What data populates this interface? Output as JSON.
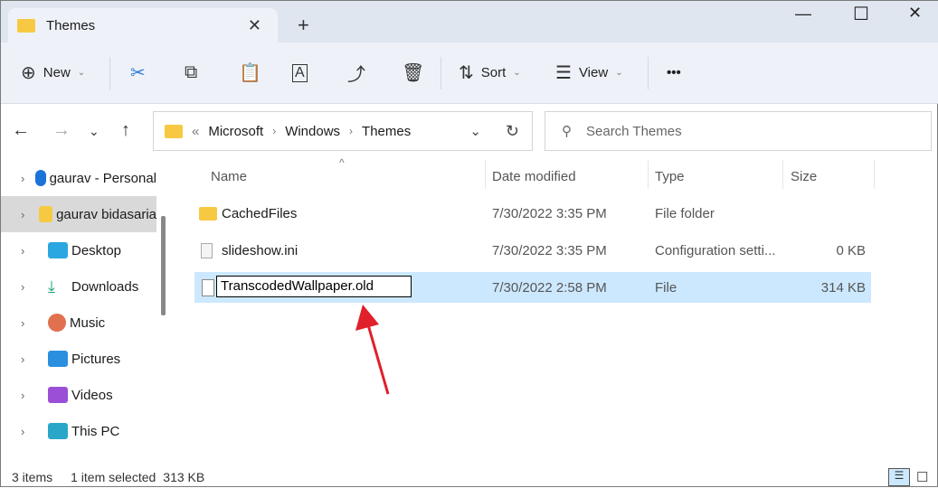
{
  "tab": {
    "title": "Themes"
  },
  "toolbar": {
    "new": "New",
    "sort": "Sort",
    "view": "View",
    "more": "•••"
  },
  "address": {
    "crumbs": [
      "Microsoft",
      "Windows",
      "Themes"
    ],
    "search_placeholder": "Search Themes"
  },
  "sidebar": {
    "items": [
      {
        "label": "gaurav - Personal",
        "color": "#1a73d9"
      },
      {
        "label": "gaurav bidasaria",
        "color": "#f7c942"
      },
      {
        "label": "Desktop",
        "color": "#2aa6e0"
      },
      {
        "label": "Downloads",
        "color": "#1aa37a"
      },
      {
        "label": "Music",
        "color": "#e0704e"
      },
      {
        "label": "Pictures",
        "color": "#2b8fe0"
      },
      {
        "label": "Videos",
        "color": "#9b4fd6"
      },
      {
        "label": "This PC",
        "color": "#2aa6c8"
      }
    ]
  },
  "columns": {
    "name": "Name",
    "date": "Date modified",
    "type": "Type",
    "size": "Size"
  },
  "files": [
    {
      "name": "CachedFiles",
      "date": "7/30/2022 3:35 PM",
      "type": "File folder",
      "size": ""
    },
    {
      "name": "slideshow.ini",
      "date": "7/30/2022 3:35 PM",
      "type": "Configuration setti...",
      "size": "0 KB"
    },
    {
      "name": "TranscodedWallpaper.old",
      "date": "7/30/2022 2:58 PM",
      "type": "File",
      "size": "314 KB"
    }
  ],
  "status": {
    "count": "3 items",
    "selected": "1 item selected",
    "size": "313 KB"
  }
}
